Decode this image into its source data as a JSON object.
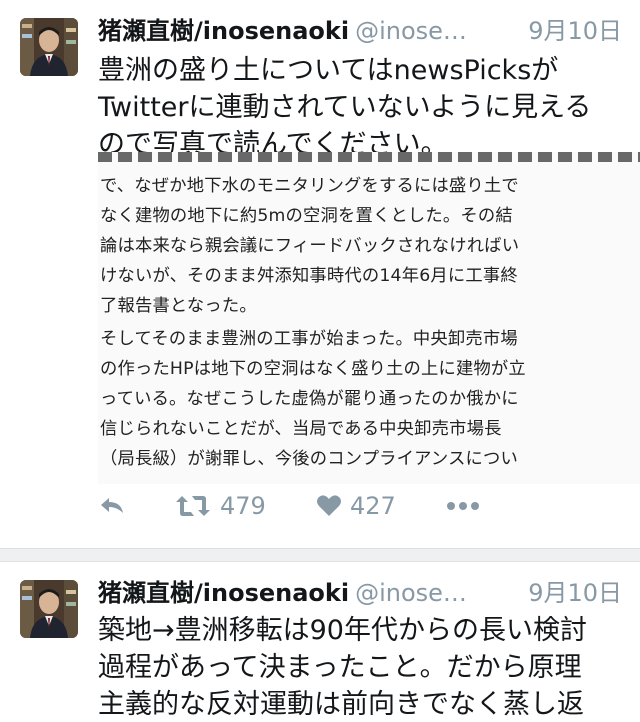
{
  "tweets": [
    {
      "name": "猪瀬直樹/inosenaoki",
      "handle": "@inose…",
      "date": "9月10日",
      "text": "豊洲の盛り土についてはnewsPicksが\nTwitterに連動されていないように見える\nので写真で読んでください。",
      "photo_lines": [
        "で、なぜか地下水のモニタリングをするには盛り土で",
        "なく建物の地下に約5mの空洞を置くとした。その結",
        "論は本来なら親会議にフィードバックされなければい",
        "けないが、そのまま舛添知事時代の14年6月に工事終",
        "了報告書となった。",
        "そしてそのまま豊洲の工事が始まった。中央卸売市場",
        "の作ったHPは地下の空洞はなく盛り土の上に建物が立",
        "っている。なぜこうした虚偽が罷り通ったのか俄かに",
        "信じられないことだが、当局である中央卸売市場長",
        "（局長級）が謝罪し、今後のコンプライアンスについ"
      ],
      "actions": {
        "reply_icon": "reply-icon",
        "retweet_icon": "retweet-icon",
        "retweet_count": "479",
        "like_icon": "heart-icon",
        "like_count": "427",
        "more_icon": "more-icon"
      }
    },
    {
      "name": "猪瀬直樹/inosenaoki",
      "handle": "@inose…",
      "date": "9月10日",
      "text": "築地→豊洲移転は90年代からの長い検討\n過程があって決まったこと。だから原理\n主義的な反対運動は前向きでなく蒸し返"
    }
  ],
  "colors": {
    "text": "#14171a",
    "muted": "#8899a6",
    "separator": "#eef0f2"
  }
}
